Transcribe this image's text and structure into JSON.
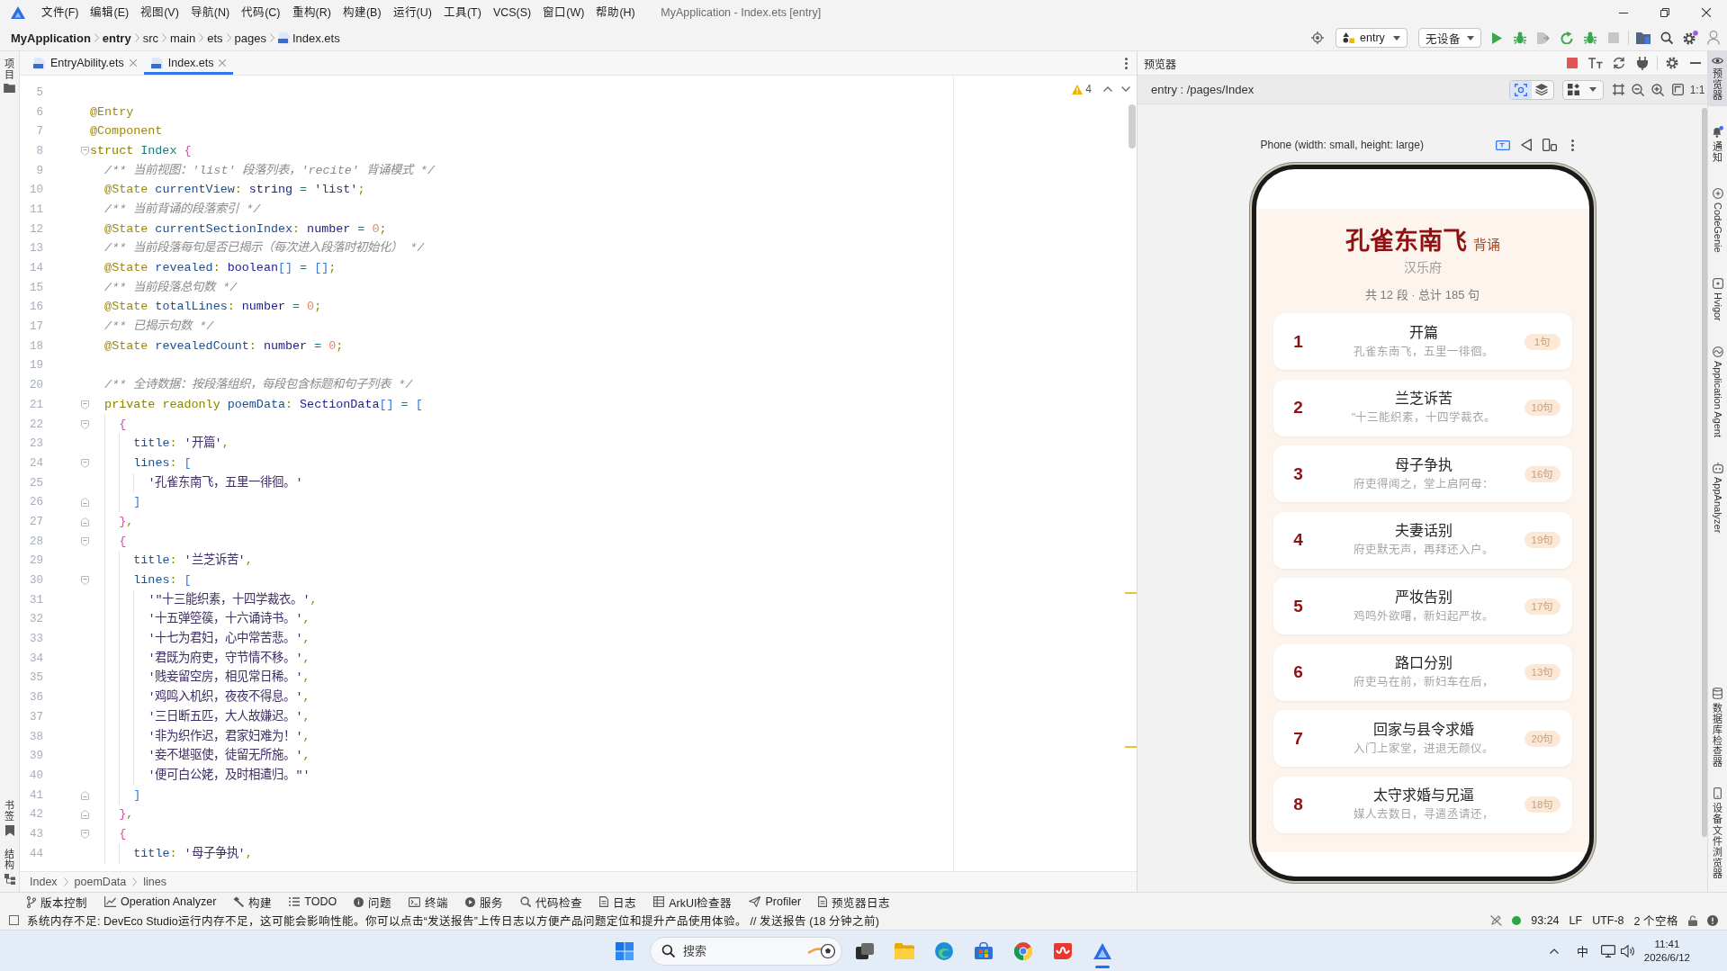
{
  "title_bar": {
    "menu": [
      "文件(F)",
      "编辑(E)",
      "视图(V)",
      "导航(N)",
      "代码(C)",
      "重构(R)",
      "构建(B)",
      "运行(U)",
      "工具(T)",
      "VCS(S)",
      "窗口(W)",
      "帮助(H)"
    ],
    "window_title": "MyApplication - Index.ets [entry]"
  },
  "navigation_bar": {
    "path": [
      {
        "kind": "project",
        "text": "MyApplication"
      },
      {
        "kind": "module",
        "text": "entry"
      },
      {
        "kind": "folder",
        "text": "src"
      },
      {
        "kind": "folder",
        "text": "main"
      },
      {
        "kind": "folder",
        "text": "ets"
      },
      {
        "kind": "folder",
        "text": "pages"
      },
      {
        "kind": "file",
        "text": "Index.ets"
      }
    ],
    "run_configuration": "entry",
    "device": "无设备"
  },
  "left_strip": {
    "top": [
      "项目"
    ],
    "bottom": [
      "书签",
      "结构"
    ]
  },
  "editor": {
    "tabs": [
      {
        "label": "EntryAbility.ets",
        "selected": false
      },
      {
        "label": "Index.ets",
        "selected": true
      }
    ],
    "warning_count": "4",
    "lines": [
      {
        "number": "5"
      },
      {
        "number": "6",
        "tokens": [
          {
            "kind": "annotation",
            "text": "@Entry"
          }
        ]
      },
      {
        "number": "7",
        "tokens": [
          {
            "kind": "annotation",
            "text": "@Component"
          }
        ]
      },
      {
        "number": "8",
        "tokens": [
          {
            "kind": "keyword",
            "text": "struct "
          },
          {
            "kind": "class",
            "text": "Index "
          },
          {
            "kind": "brace",
            "text": "{"
          }
        ],
        "children": [
          {
            "number": "9",
            "tokens": [
              {
                "kind": "comment",
                "text": "/** 当前视图：'list' 段落列表，'recite' 背诵模式 */"
              }
            ]
          },
          {
            "number": "10",
            "tokens": [
              {
                "kind": "annotation",
                "text": "@State "
              },
              {
                "kind": "property",
                "text": "currentView"
              },
              {
                "kind": "punctuation",
                "text": ": "
              },
              {
                "kind": "type",
                "text": "string"
              },
              {
                "kind": "operator",
                "text": " = "
              },
              {
                "kind": "string",
                "text": "'list'"
              },
              {
                "kind": "punctuation",
                "text": ";"
              }
            ]
          },
          {
            "number": "11",
            "tokens": [
              {
                "kind": "comment",
                "text": "/** 当前背诵的段落索引 */"
              }
            ]
          },
          {
            "number": "12",
            "tokens": [
              {
                "kind": "annotation",
                "text": "@State "
              },
              {
                "kind": "property",
                "text": "currentSectionIndex"
              },
              {
                "kind": "punctuation",
                "text": ": "
              },
              {
                "kind": "type",
                "text": "number"
              },
              {
                "kind": "operator",
                "text": " = "
              },
              {
                "kind": "number",
                "text": "0"
              },
              {
                "kind": "punctuation",
                "text": ";"
              }
            ]
          },
          {
            "number": "13",
            "tokens": [
              {
                "kind": "comment",
                "text": "/** 当前段落每句是否已揭示（每次进入段落时初始化） */"
              }
            ]
          },
          {
            "number": "14",
            "tokens": [
              {
                "kind": "annotation",
                "text": "@State "
              },
              {
                "kind": "property",
                "text": "revealed"
              },
              {
                "kind": "punctuation",
                "text": ": "
              },
              {
                "kind": "type",
                "text": "boolean"
              },
              {
                "kind": "bracket",
                "text": "[]"
              },
              {
                "kind": "operator",
                "text": " = "
              },
              {
                "kind": "bracket",
                "text": "[]"
              },
              {
                "kind": "punctuation",
                "text": ";"
              }
            ]
          },
          {
            "number": "15",
            "tokens": [
              {
                "kind": "comment",
                "text": "/** 当前段落总句数 */"
              }
            ]
          },
          {
            "number": "16",
            "tokens": [
              {
                "kind": "annotation",
                "text": "@State "
              },
              {
                "kind": "property",
                "text": "totalLines"
              },
              {
                "kind": "punctuation",
                "text": ": "
              },
              {
                "kind": "type",
                "text": "number"
              },
              {
                "kind": "operator",
                "text": " = "
              },
              {
                "kind": "number",
                "text": "0"
              },
              {
                "kind": "punctuation",
                "text": ";"
              }
            ]
          },
          {
            "number": "17",
            "tokens": [
              {
                "kind": "comment",
                "text": "/** 已揭示句数 */"
              }
            ]
          },
          {
            "number": "18",
            "tokens": [
              {
                "kind": "annotation",
                "text": "@State "
              },
              {
                "kind": "property",
                "text": "revealedCount"
              },
              {
                "kind": "punctuation",
                "text": ": "
              },
              {
                "kind": "type",
                "text": "number"
              },
              {
                "kind": "operator",
                "text": " = "
              },
              {
                "kind": "number",
                "text": "0"
              },
              {
                "kind": "punctuation",
                "text": ";"
              }
            ]
          },
          {
            "number": "19"
          },
          {
            "number": "20",
            "tokens": [
              {
                "kind": "comment",
                "text": "/** 全诗数据：按段落组织，每段包含标题和句子列表 */"
              }
            ]
          },
          {
            "number": "21",
            "tokens": [
              {
                "kind": "keyword",
                "text": "private readonly "
              },
              {
                "kind": "property",
                "text": "poemData"
              },
              {
                "kind": "punctuation",
                "text": ": "
              },
              {
                "kind": "type",
                "text": "SectionData"
              },
              {
                "kind": "bracket",
                "text": "[]"
              },
              {
                "kind": "operator",
                "text": " = "
              },
              {
                "kind": "bracket",
                "text": "["
              }
            ],
            "children": [
              {
                "number": "22",
                "tokens": [
                  {
                    "kind": "brace",
                    "text": "{"
                  }
                ],
                "children": [
                  {
                    "number": "23",
                    "tokens": [
                      {
                        "kind": "property",
                        "text": "title"
                      },
                      {
                        "kind": "punctuation",
                        "text": ": "
                      },
                      {
                        "kind": "string",
                        "text": "'开篇'"
                      },
                      {
                        "kind": "punctuation",
                        "text": ","
                      }
                    ]
                  },
                  {
                    "number": "24",
                    "tokens": [
                      {
                        "kind": "property",
                        "text": "lines"
                      },
                      {
                        "kind": "punctuation",
                        "text": ": "
                      },
                      {
                        "kind": "bracket",
                        "text": "["
                      }
                    ],
                    "children": [
                      {
                        "number": "25",
                        "tokens": [
                          {
                            "kind": "string",
                            "text": "'孔雀东南飞，五里一徘徊。'"
                          }
                        ]
                      }
                    ],
                    "close": {
                      "number": "26",
                      "tokens": [
                        {
                          "kind": "bracket",
                          "text": "]"
                        }
                      ]
                    }
                  }
                ],
                "close": {
                  "number": "27",
                  "tokens": [
                    {
                      "kind": "brace",
                      "text": "}"
                    },
                    {
                      "kind": "punctuation",
                      "text": ","
                    }
                  ]
                }
              },
              {
                "number": "28",
                "tokens": [
                  {
                    "kind": "brace",
                    "text": "{"
                  }
                ],
                "children": [
                  {
                    "number": "29",
                    "tokens": [
                      {
                        "kind": "property",
                        "text": "title"
                      },
                      {
                        "kind": "punctuation",
                        "text": ": "
                      },
                      {
                        "kind": "string",
                        "text": "'兰芝诉苦'"
                      },
                      {
                        "kind": "punctuation",
                        "text": ","
                      }
                    ]
                  },
                  {
                    "number": "30",
                    "tokens": [
                      {
                        "kind": "property",
                        "text": "lines"
                      },
                      {
                        "kind": "punctuation",
                        "text": ": "
                      },
                      {
                        "kind": "bracket",
                        "text": "["
                      }
                    ],
                    "children": [
                      {
                        "number": "31",
                        "tokens": [
                          {
                            "kind": "string",
                            "text": "'\"十三能织素，十四学裁衣。'"
                          },
                          {
                            "kind": "punctuation",
                            "text": ","
                          }
                        ]
                      },
                      {
                        "number": "32",
                        "tokens": [
                          {
                            "kind": "string",
                            "text": "'十五弹箜篌，十六诵诗书。'"
                          },
                          {
                            "kind": "punctuation",
                            "text": ","
                          }
                        ]
                      },
                      {
                        "number": "33",
                        "tokens": [
                          {
                            "kind": "string",
                            "text": "'十七为君妇，心中常苦悲。'"
                          },
                          {
                            "kind": "punctuation",
                            "text": ","
                          }
                        ]
                      },
                      {
                        "number": "34",
                        "tokens": [
                          {
                            "kind": "string",
                            "text": "'君既为府吏，守节情不移。'"
                          },
                          {
                            "kind": "punctuation",
                            "text": ","
                          }
                        ]
                      },
                      {
                        "number": "35",
                        "tokens": [
                          {
                            "kind": "string",
                            "text": "'贱妾留空房，相见常日稀。'"
                          },
                          {
                            "kind": "punctuation",
                            "text": ","
                          }
                        ]
                      },
                      {
                        "number": "36",
                        "tokens": [
                          {
                            "kind": "string",
                            "text": "'鸡鸣入机织，夜夜不得息。'"
                          },
                          {
                            "kind": "punctuation",
                            "text": ","
                          }
                        ]
                      },
                      {
                        "number": "37",
                        "tokens": [
                          {
                            "kind": "string",
                            "text": "'三日断五匹，大人故嫌迟。'"
                          },
                          {
                            "kind": "punctuation",
                            "text": ","
                          }
                        ]
                      },
                      {
                        "number": "38",
                        "tokens": [
                          {
                            "kind": "string",
                            "text": "'非为织作迟，君家妇难为！'"
                          },
                          {
                            "kind": "punctuation",
                            "text": ","
                          }
                        ]
                      },
                      {
                        "number": "39",
                        "tokens": [
                          {
                            "kind": "string",
                            "text": "'妾不堪驱使，徒留无所施。'"
                          },
                          {
                            "kind": "punctuation",
                            "text": ","
                          }
                        ]
                      },
                      {
                        "number": "40",
                        "tokens": [
                          {
                            "kind": "string",
                            "text": "'便可白公姥，及时相遣归。\"'"
                          }
                        ]
                      }
                    ],
                    "close": {
                      "number": "41",
                      "tokens": [
                        {
                          "kind": "bracket",
                          "text": "]"
                        }
                      ]
                    }
                  }
                ],
                "close": {
                  "number": "42",
                  "tokens": [
                    {
                      "kind": "brace",
                      "text": "}"
                    },
                    {
                      "kind": "punctuation",
                      "text": ","
                    }
                  ]
                }
              },
              {
                "number": "43",
                "tokens": [
                  {
                    "kind": "brace",
                    "text": "{"
                  }
                ],
                "children": [
                  {
                    "number": "44",
                    "tokens": [
                      {
                        "kind": "property",
                        "text": "title"
                      },
                      {
                        "kind": "punctuation",
                        "text": ": "
                      },
                      {
                        "kind": "string",
                        "text": "'母子争执'"
                      },
                      {
                        "kind": "punctuation",
                        "text": ","
                      }
                    ]
                  }
                ]
              }
            ]
          }
        ]
      }
    ],
    "breadcrumb": [
      "Index",
      "poemData",
      "lines"
    ]
  },
  "preview": {
    "title": "预览器",
    "route": "entry : /pages/Index",
    "component_inspector": {
      "on": true
    },
    "actual_size": "1:1",
    "device_label": "Phone (width: small, height: large)",
    "app": {
      "title": "孔雀东南飞",
      "mode": "背诵",
      "author": "汉乐府",
      "summary": "共 12 段 · 总计 185 句",
      "sections": [
        {
          "index": "1",
          "title": "开篇",
          "first_line": "孔雀东南飞，五里一徘徊。",
          "count": "1句"
        },
        {
          "index": "2",
          "title": "兰芝诉苦",
          "first_line": "\"十三能织素，十四学裁衣。",
          "count": "10句"
        },
        {
          "index": "3",
          "title": "母子争执",
          "first_line": "府吏得闻之，堂上启阿母：",
          "count": "16句"
        },
        {
          "index": "4",
          "title": "夫妻话别",
          "first_line": "府吏默无声，再拜还入户。",
          "count": "19句"
        },
        {
          "index": "5",
          "title": "严妆告别",
          "first_line": "鸡鸣外欲曙，新妇起严妆。",
          "count": "17句"
        },
        {
          "index": "6",
          "title": "路口分别",
          "first_line": "府吏马在前，新妇车在后，",
          "count": "13句"
        },
        {
          "index": "7",
          "title": "回家与县令求婚",
          "first_line": "入门上家堂，进退无颜仪。",
          "count": "20句"
        },
        {
          "index": "8",
          "title": "太守求婚与兄逼",
          "first_line": "媒人去数日，寻遣丞请还，",
          "count": "18句"
        }
      ]
    }
  },
  "right_strip": {
    "top": [
      {
        "label": "预览器",
        "kind": "stacked",
        "selected": true
      },
      {
        "label": "通知",
        "kind": "stacked",
        "selected": false
      },
      {
        "label": "CodeGenie",
        "kind": "rotated",
        "selected": false
      },
      {
        "label": "Hvigor",
        "kind": "rotated",
        "selected": false
      },
      {
        "label": "Application Agent",
        "kind": "rotated",
        "selected": false
      },
      {
        "label": "AppAnalyzer",
        "kind": "rotated",
        "selected": false
      }
    ],
    "bottom": [
      {
        "label": "数据库检查器",
        "kind": "stacked",
        "selected": false
      },
      {
        "label": "设备文件浏览器",
        "kind": "stacked",
        "selected": false
      }
    ]
  },
  "tool_windows": [
    "版本控制",
    "Operation Analyzer",
    "构建",
    "TODO",
    "问题",
    "终端",
    "服务",
    "代码检查",
    "日志",
    "ArkUI检查器",
    "Profiler",
    "预览器日志"
  ],
  "status_bar": {
    "message": "系统内存不足: DevEco Studio运行内存不足，这可能会影响性能。你可以点击“发送报告”上传日志以方便产品问题定位和提升产品使用体验。 // 发送报告 (18 分钟之前)",
    "caret_position": "93:24",
    "line_separator": "LF",
    "encoding": "UTF-8",
    "indentation": "2 个空格"
  },
  "taskbar": {
    "search": {
      "placeholder": "搜索"
    },
    "apps": [
      {
        "active": false
      },
      {
        "active": false
      },
      {
        "active": false
      },
      {
        "active": false
      },
      {
        "active": false
      },
      {
        "active": false
      },
      {
        "active": true
      }
    ],
    "input_method": "中",
    "time": "11:41",
    "date": "2026/6/12"
  }
}
